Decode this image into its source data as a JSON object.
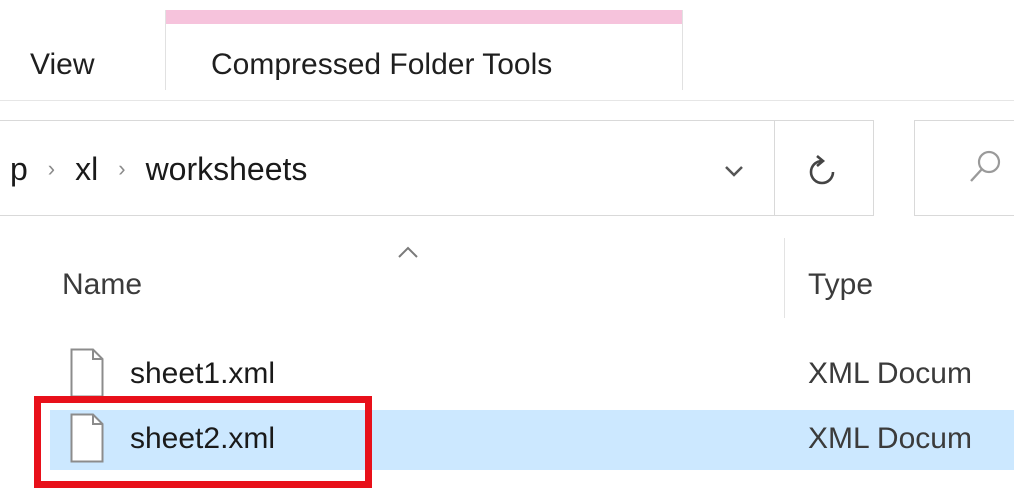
{
  "ribbon": {
    "tabs": [
      {
        "label": "View"
      },
      {
        "label": "Compressed Folder Tools"
      }
    ],
    "contextual_band_color": "#f6c3dc"
  },
  "address_bar": {
    "breadcrumbs": [
      "p",
      "xl",
      "worksheets"
    ],
    "separator_icon": "chevron-right-icon",
    "dropdown_icon": "chevron-down-icon",
    "refresh_icon": "refresh-icon"
  },
  "search": {
    "icon": "search-icon"
  },
  "columns": {
    "name": "Name",
    "type": "Type",
    "sort_icon": "sort-ascending-icon"
  },
  "files": [
    {
      "name": "sheet1.xml",
      "type": "XML Docum",
      "selected": false,
      "icon": "file-icon"
    },
    {
      "name": "sheet2.xml",
      "type": "XML Docum",
      "selected": true,
      "icon": "file-icon"
    }
  ],
  "colors": {
    "selection": "#cce8ff",
    "highlight_box": "#e8101a"
  }
}
